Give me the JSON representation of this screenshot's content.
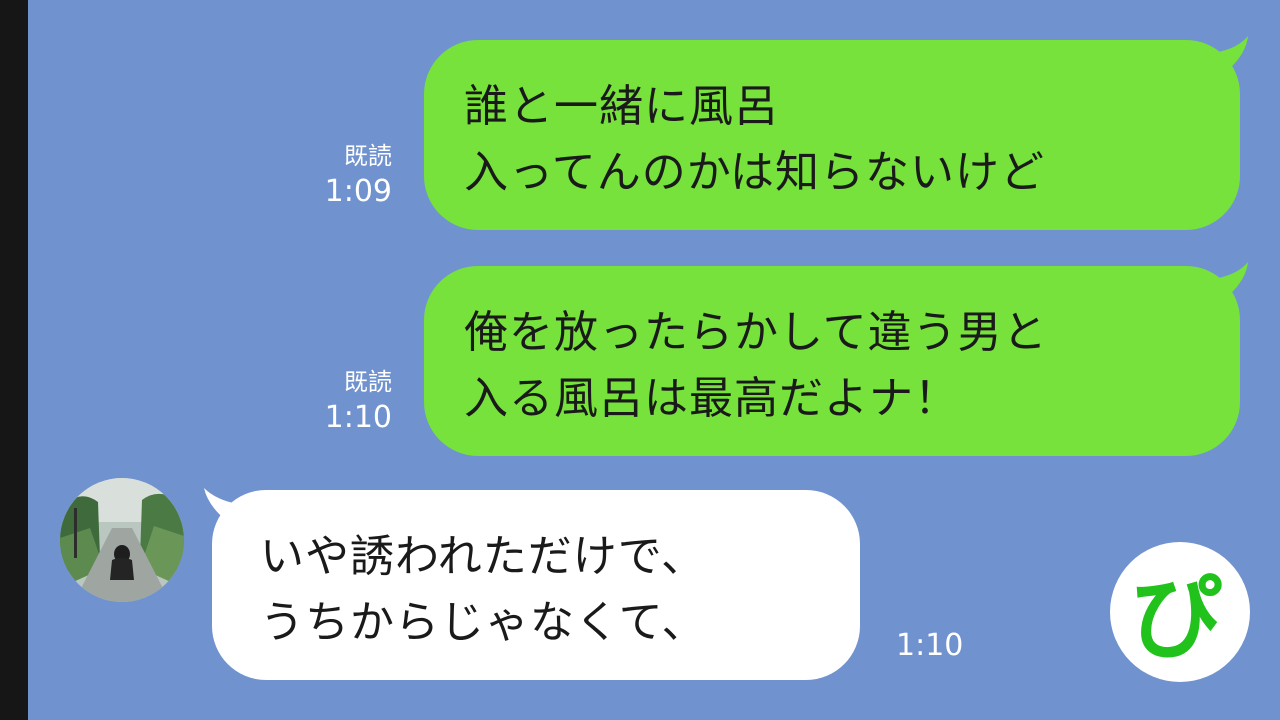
{
  "messages": [
    {
      "direction": "sent",
      "lines": [
        "誰と一緒に風呂",
        "入ってんのかは知らないけど"
      ],
      "read_label": "既読",
      "time": "1:09"
    },
    {
      "direction": "sent",
      "lines": [
        "俺を放ったらかして違う男と",
        "入る風呂は最高だよナ！"
      ],
      "read_label": "既読",
      "time": "1:10"
    },
    {
      "direction": "received",
      "lines": [
        "いや誘われただけで、",
        "うちからじゃなくて、"
      ],
      "time": "1:10"
    }
  ],
  "badge": {
    "text": "ぴ",
    "color": "#21c21c"
  },
  "colors": {
    "background": "#7093cf",
    "sent_bubble": "#76e23b",
    "received_bubble": "#ffffff"
  },
  "icons": {
    "avatar": "avatar-photo",
    "badge": "pi-logo-icon"
  }
}
